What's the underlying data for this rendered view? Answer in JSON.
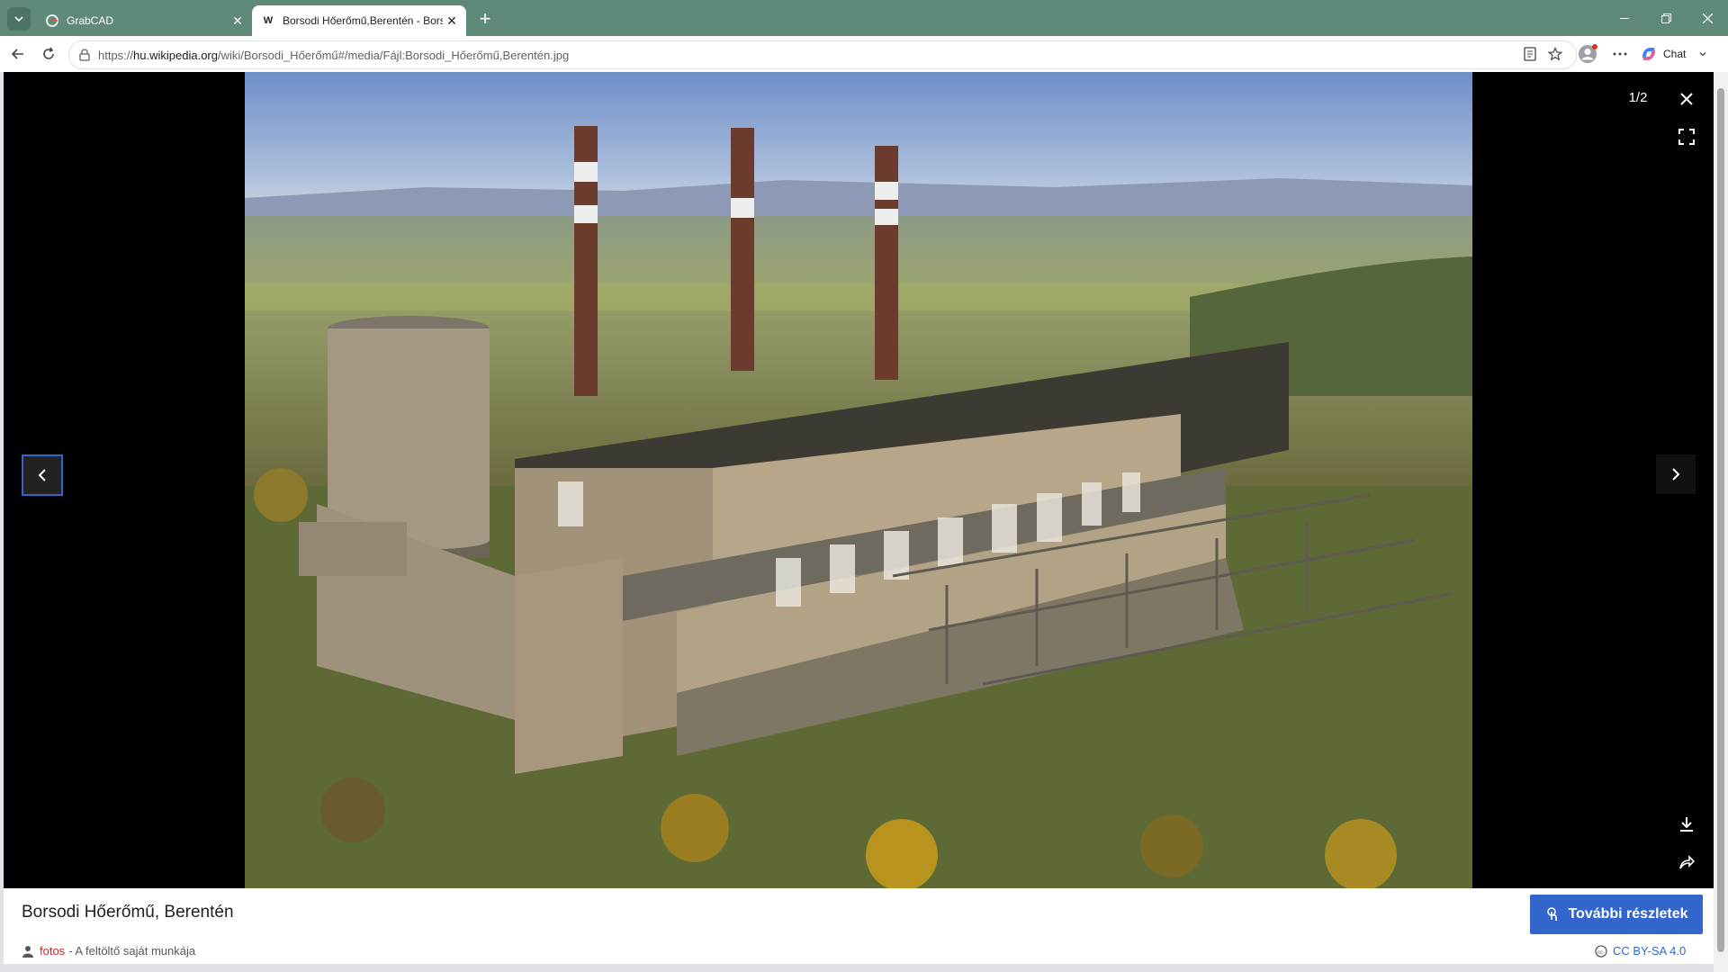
{
  "browser": {
    "tabs": [
      {
        "title": "GrabCAD",
        "favicon": "grabcad-icon"
      },
      {
        "title": "Borsodi Hőerőmű,Berentén - Borsodi Hőerőmű",
        "favicon": "wikipedia-icon",
        "favicon_glyph": "W"
      }
    ],
    "url_prefix": "https://",
    "url_host": "hu.wikipedia.org",
    "url_path": "/wiki/Borsodi_Hőerőmű#/media/Fájl:Borsodi_Hőerőmű,Berentén.jpg",
    "chat_label": "Chat",
    "colors": {
      "titlebar": "#5f8a78",
      "accent": "#3366cc"
    }
  },
  "viewer": {
    "counter": "1/2",
    "image_alt": "Borsodi Hőerőmű, Berentén",
    "caption": "Borsodi Hőerőmű, Berentén",
    "more_details_label": "További részletek",
    "author_link": "fotos",
    "author_suffix": "- A feltöltő saját munkája",
    "license": "CC BY-SA 4.0"
  }
}
